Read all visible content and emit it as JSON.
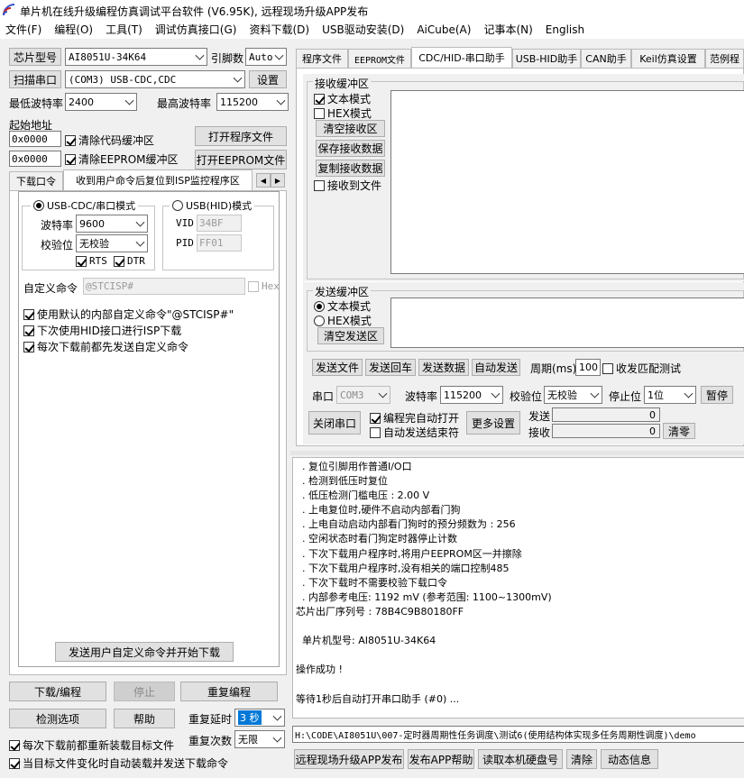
{
  "title": "单片机在线升级编程仿真调试平台软件 (V6.95K), 远程现场升级APP发布",
  "menu": [
    "文件(F)",
    "编程(O)",
    "工具(T)",
    "调试仿真接口(G)",
    "资料下载(D)",
    "USB驱动安装(D)",
    "AiCube(A)",
    "记事本(N)",
    "English"
  ],
  "left": {
    "chip_label": "芯片型号",
    "chip_value": "AI8051U-34K64",
    "pin_label": "引脚数",
    "pin_value": "Auto",
    "scan_label": "扫描串口",
    "port_value": "(COM3) USB-CDC,CDC",
    "settings_label": "设置",
    "min_baud_label": "最低波特率",
    "min_baud_value": "2400",
    "max_baud_label": "最高波特率",
    "max_baud_value": "115200",
    "start_addr_label": "起始地址",
    "addr1": "0x0000",
    "clear_code_label": "清除代码缓冲区",
    "open_prog_label": "打开程序文件",
    "addr2": "0x0000",
    "clear_eeprom_label": "清除EEPROM缓冲区",
    "open_eeprom_label": "打开EEPROM文件",
    "tabs": [
      "下载口令",
      "收到用户命令后复位到ISP监控程序区"
    ],
    "cdc_mode_label": "USB-CDC/串口模式",
    "hid_mode_label": "USB(HID)模式",
    "baud_label": "波特率",
    "baud_value": "9600",
    "parity_label": "校验位",
    "parity_value": "无校验",
    "rts_label": "RTS",
    "dtr_label": "DTR",
    "vid_label": "VID",
    "vid_value": "34BF",
    "pid_label": "PID",
    "pid_value": "FF01",
    "custom_cmd_label": "自定义命令",
    "custom_cmd_value": "@STCISP#",
    "hex_label": "Hex",
    "opt1": "使用默认的内部自定义命令\"@STCISP#\"",
    "opt2": "下次使用HID接口进行ISP下载",
    "opt3": "每次下载前都先发送自定义命令",
    "send_cmd_label": "发送用户自定义命令并开始下载",
    "download_label": "下载/编程",
    "stop_label": "停止",
    "reprogram_label": "重复编程",
    "check_label": "检测选项",
    "help_label": "帮助",
    "delay_label": "重复延时",
    "delay_value": "3 秒",
    "count_label": "重复次数",
    "count_value": "无限",
    "reload_label": "每次下载前都重新装载目标文件",
    "auto_load_label": "当目标文件变化时自动装载并发送下载命令"
  },
  "right": {
    "tabs": [
      "程序文件",
      "EEPROM文件",
      "CDC/HID-串口助手",
      "USB-HID助手",
      "CAN助手",
      "Keil仿真设置",
      "范例程"
    ],
    "recv_group": "接收缓冲区",
    "recv_text": "文本模式",
    "recv_hex": "HEX模式",
    "clear_recv": "清空接收区",
    "save_recv": "保存接收数据",
    "copy_recv": "复制接收数据",
    "recv_to_file": "接收到文件",
    "send_group": "发送缓冲区",
    "send_text": "文本模式",
    "send_hex": "HEX模式",
    "clear_send": "清空发送区",
    "send_file": "发送文件",
    "send_enter": "发送回车",
    "send_data": "发送数据",
    "auto_send": "自动发送",
    "period_label": "周期(ms)",
    "period_value": "100",
    "match_label": "收发匹配测试",
    "port_label": "串口",
    "port_value": "COM3",
    "baud_label": "波特率",
    "baud_value": "115200",
    "parity_label": "校验位",
    "parity_value": "无校验",
    "stop_label": "停止位",
    "stop_value": "1位",
    "pause_label": "暂停",
    "close_port": "关闭串口",
    "auto_open": "编程完自动打开",
    "auto_end": "自动发送结束符",
    "more_settings": "更多设置",
    "send_count_label": "发送",
    "send_count": "0",
    "recv_count_label": "接收",
    "recv_count": "0",
    "clear_count": "清零"
  },
  "log": [
    "  . 复位引脚用作普通I/O口",
    "  . 检测到低压时复位",
    "  . 低压检测门槛电压 : 2.00 V",
    "  . 上电复位时,硬件不启动内部看门狗",
    "  . 上电自动启动内部看门狗时的预分频数为 : 256",
    "  . 空闲状态时看门狗定时器停止计数",
    "  . 下次下载用户程序时,将用户EEPROM区一并擦除",
    "  . 下次下载用户程序时,没有相关的端口控制485",
    "  . 下次下载时不需要校验下载口令",
    "  . 内部参考电压: 1192 mV (参考范围: 1100~1300mV)",
    "芯片出厂序列号 : 78B4C9B80180FF",
    "",
    "  单片机型号: AI8051U-34K64",
    "",
    "操作成功 !",
    "",
    "等待1秒后自动打开串口助手 (#0) ..."
  ],
  "path": "H:\\CODE\\AI8051U\\007-定时器周期性任务调度\\测试6(使用结构体实现多任务周期性调度)\\demo",
  "bottom_buttons": [
    "远程现场升级APP发布",
    "发布APP帮助",
    "读取本机硬盘号",
    "清除",
    "动态信息"
  ]
}
